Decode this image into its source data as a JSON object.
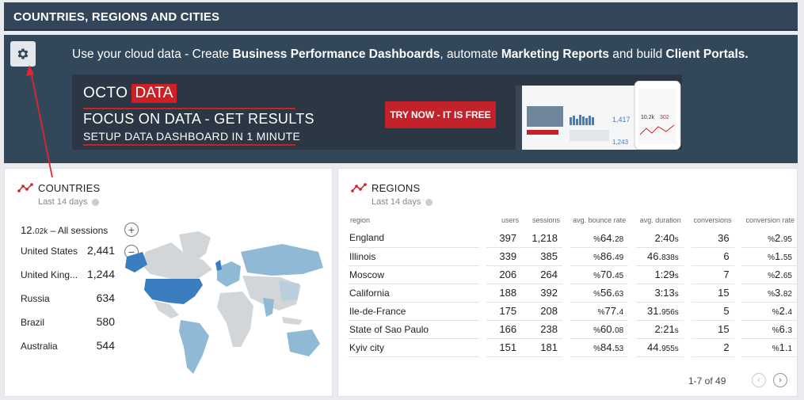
{
  "header": {
    "title": "COUNTRIES, REGIONS AND CITIES"
  },
  "promo": {
    "text_parts": [
      "Use your cloud data - Create ",
      "Business Performance Dashboards",
      ", automate ",
      "Marketing Reports",
      " and build ",
      "Client Portals."
    ],
    "banner": {
      "logo_left": "OCTO",
      "logo_right": "DATA",
      "headline": "FOCUS ON DATA - GET RESULTS",
      "subline": "SETUP DATA DASHBOARD IN 1 MINUTE",
      "cta": "TRY NOW - IT IS FREE",
      "mockup_numbers": [
        "1,417",
        "10.2k",
        "302",
        "1,243"
      ]
    }
  },
  "countries": {
    "title": "COUNTRIES",
    "subtitle": "Last 14 days",
    "total": {
      "value": "12.",
      "value_small": "02k",
      "label": " – All sessions"
    },
    "rows": [
      {
        "name": "United States",
        "value": "2,441"
      },
      {
        "name": "United King...",
        "value": "1,244"
      },
      {
        "name": "Russia",
        "value": "634"
      },
      {
        "name": "Brazil",
        "value": "580"
      },
      {
        "name": "Australia",
        "value": "544"
      }
    ],
    "expand_symbol": "+",
    "collapse_symbol": "−"
  },
  "regions": {
    "title": "REGIONS",
    "subtitle": "Last 14 days",
    "columns": [
      "region",
      "users",
      "sessions",
      "avg. bounce rate",
      "avg. duration",
      "conversions",
      "conversion rate"
    ],
    "rows": [
      {
        "region": "England",
        "users": "397",
        "sessions": "1,218",
        "bounce_main": "64.",
        "bounce_small": "28",
        "dur_main": "2:40",
        "dur_small": "s",
        "conversions": "36",
        "rate_main": "2.",
        "rate_small": "95"
      },
      {
        "region": "Illinois",
        "users": "339",
        "sessions": "385",
        "bounce_main": "86.",
        "bounce_small": "49",
        "dur_main": "46.",
        "dur_small": "838s",
        "conversions": "6",
        "rate_main": "1.",
        "rate_small": "55"
      },
      {
        "region": "Moscow",
        "users": "206",
        "sessions": "264",
        "bounce_main": "70.",
        "bounce_small": "45",
        "dur_main": "1:29",
        "dur_small": "s",
        "conversions": "7",
        "rate_main": "2.",
        "rate_small": "65"
      },
      {
        "region": "California",
        "users": "188",
        "sessions": "392",
        "bounce_main": "56.",
        "bounce_small": "63",
        "dur_main": "3:13",
        "dur_small": "s",
        "conversions": "15",
        "rate_main": "3.",
        "rate_small": "82"
      },
      {
        "region": "Ile-de-France",
        "users": "175",
        "sessions": "208",
        "bounce_main": "77.",
        "bounce_small": "4",
        "dur_main": "31.",
        "dur_small": "956s",
        "conversions": "5",
        "rate_main": "2.",
        "rate_small": "4"
      },
      {
        "region": "State of Sao Paulo",
        "users": "166",
        "sessions": "238",
        "bounce_main": "60.",
        "bounce_small": "08",
        "dur_main": "2:21",
        "dur_small": "s",
        "conversions": "15",
        "rate_main": "6.",
        "rate_small": "3"
      },
      {
        "region": "Kyiv city",
        "users": "151",
        "sessions": "181",
        "bounce_main": "84.",
        "bounce_small": "53",
        "dur_main": "44.",
        "dur_small": "955s",
        "conversions": "2",
        "rate_main": "1.",
        "rate_small": "1"
      }
    ],
    "percent_sign": "%",
    "pager": "1-7 of 49",
    "prev_symbol": "‹",
    "next_symbol": "›"
  },
  "colors": {
    "header_bg": "#334659",
    "accent_red": "#cc2026",
    "map_highlight": "#3b7ec0",
    "map_light": "#8fb9d4",
    "map_land": "#d3d6d9"
  }
}
